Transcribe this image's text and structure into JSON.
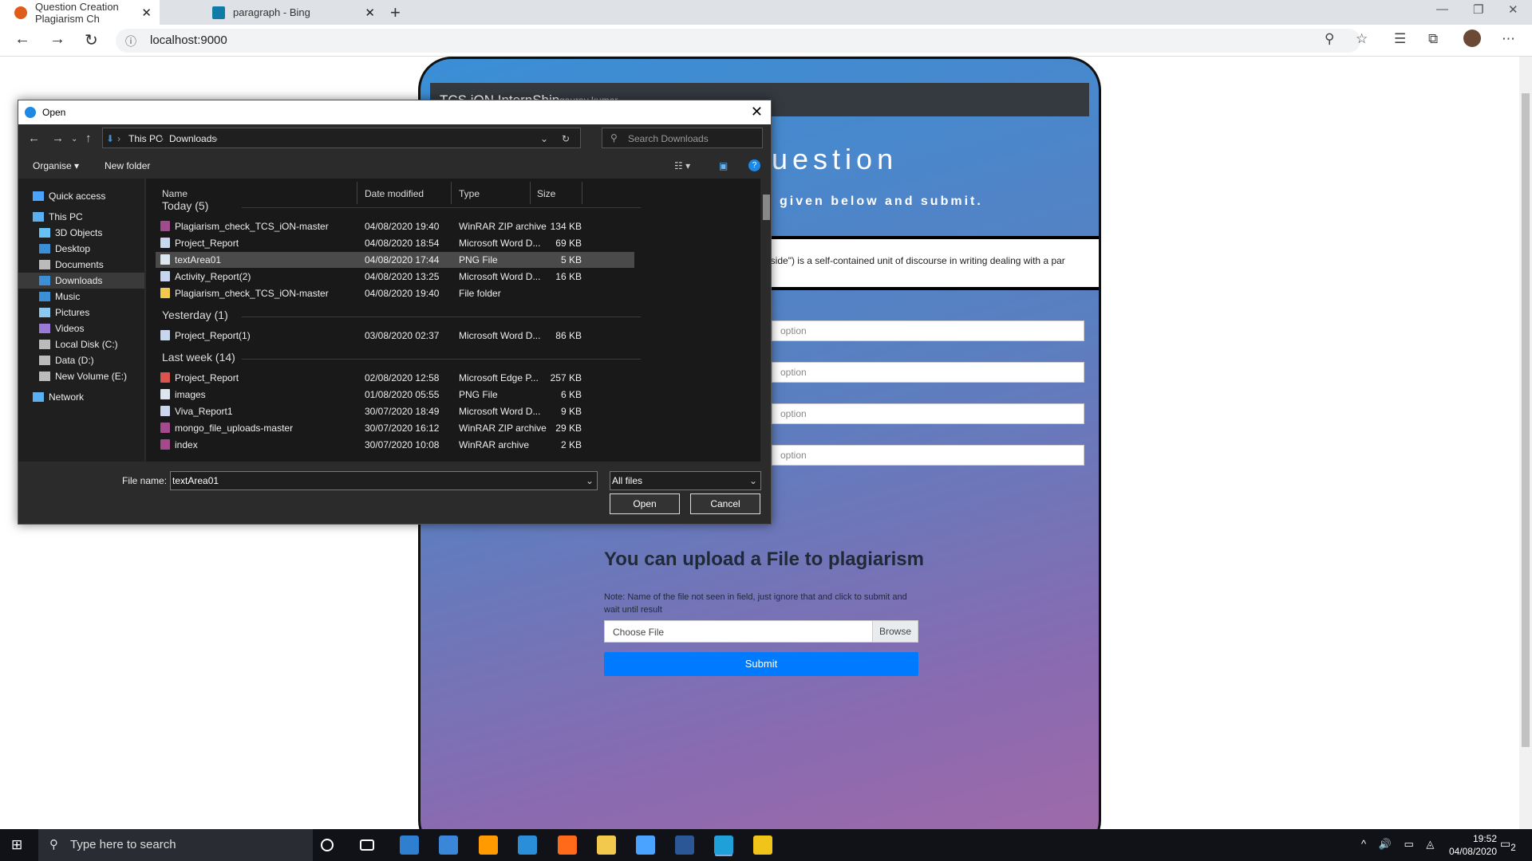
{
  "browser": {
    "tabs": [
      {
        "title": "Question Creation Plagiarism Ch",
        "icon": "page-favicon-icon",
        "color": "#e05c1a"
      },
      {
        "title": "paragraph - Bing",
        "icon": "bing-icon",
        "color": "#0f7ca8"
      }
    ],
    "url": "localhost:9000"
  },
  "page": {
    "brand": "TCS iON InternShip",
    "user": "gaurav kumar",
    "heading": "uestion",
    "subheading": "given below and submit.",
    "question_text": "eside\") is a self-contained unit of discourse in writing dealing with a par",
    "options": [
      "option",
      "option",
      "option",
      "option"
    ],
    "upload_title": "You can upload a File to plagiarism",
    "upload_note": "Note: Name of the file not seen in field, just ignore that and click to submit and wait until result",
    "file_placeholder": "Choose File",
    "browse_label": "Browse",
    "submit_label": "Submit"
  },
  "dialog": {
    "title": "Open",
    "breadcrumb": [
      "This PC",
      "Downloads"
    ],
    "search_placeholder": "Search Downloads",
    "organise": "Organise",
    "new_folder": "New folder",
    "sidebar": [
      {
        "label": "Quick access",
        "icon": "star-icon",
        "color": "#4aa3ff"
      },
      {
        "label": "This PC",
        "icon": "pc-icon",
        "color": "#5ab0f0"
      },
      {
        "label": "3D Objects",
        "icon": "3d-objects-icon",
        "color": "#66c1f5"
      },
      {
        "label": "Desktop",
        "icon": "desktop-icon",
        "color": "#3b8fd6"
      },
      {
        "label": "Documents",
        "icon": "documents-icon",
        "color": "#bbbbbb"
      },
      {
        "label": "Downloads",
        "icon": "downloads-icon",
        "color": "#3b8fd6"
      },
      {
        "label": "Music",
        "icon": "music-icon",
        "color": "#3b8fd6"
      },
      {
        "label": "Pictures",
        "icon": "pictures-icon",
        "color": "#8cc8f0"
      },
      {
        "label": "Videos",
        "icon": "videos-icon",
        "color": "#9b79d6"
      },
      {
        "label": "Local Disk (C:)",
        "icon": "drive-icon",
        "color": "#bbbbbb"
      },
      {
        "label": "Data (D:)",
        "icon": "drive-icon",
        "color": "#bbbbbb"
      },
      {
        "label": "New Volume (E:)",
        "icon": "drive-icon",
        "color": "#bbbbbb"
      },
      {
        "label": "Network",
        "icon": "network-icon",
        "color": "#5ab0f0"
      }
    ],
    "columns": [
      "Name",
      "Date modified",
      "Type",
      "Size"
    ],
    "groups": [
      {
        "label": "Today (5)",
        "rows": [
          {
            "name": "Plagiarism_check_TCS_iON-master",
            "date": "04/08/2020 19:40",
            "type": "WinRAR ZIP archive",
            "size": "134 KB",
            "icon": "winrar-icon",
            "color": "#a34a8c"
          },
          {
            "name": "Project_Report",
            "date": "04/08/2020 18:54",
            "type": "Microsoft Word D...",
            "size": "69 KB",
            "icon": "word-doc-icon",
            "color": "#c8d6ee"
          },
          {
            "name": "textArea01",
            "date": "04/08/2020 17:44",
            "type": "PNG File",
            "size": "5 KB",
            "icon": "png-file-icon",
            "color": "#dde6f0"
          },
          {
            "name": "Activity_Report(2)",
            "date": "04/08/2020 13:25",
            "type": "Microsoft Word D...",
            "size": "16 KB",
            "icon": "word-doc-icon",
            "color": "#c8d6ee"
          },
          {
            "name": "Plagiarism_check_TCS_iON-master",
            "date": "04/08/2020 19:40",
            "type": "File folder",
            "size": "",
            "icon": "folder-icon",
            "color": "#f2c94c"
          }
        ]
      },
      {
        "label": "Yesterday (1)",
        "rows": [
          {
            "name": "Project_Report(1)",
            "date": "03/08/2020 02:37",
            "type": "Microsoft Word D...",
            "size": "86 KB",
            "icon": "word-doc-icon",
            "color": "#c8d6ee"
          }
        ]
      },
      {
        "label": "Last week (14)",
        "rows": [
          {
            "name": "Project_Report",
            "date": "02/08/2020 12:58",
            "type": "Microsoft Edge P...",
            "size": "257 KB",
            "icon": "pdf-icon",
            "color": "#d9534f"
          },
          {
            "name": "images",
            "date": "01/08/2020 05:55",
            "type": "PNG File",
            "size": "6 KB",
            "icon": "png-file-icon",
            "color": "#dde6f0"
          },
          {
            "name": "Viva_Report1",
            "date": "30/07/2020 18:49",
            "type": "Microsoft Word D...",
            "size": "9 KB",
            "icon": "word-doc-icon",
            "color": "#c8d6ee"
          },
          {
            "name": "mongo_file_uploads-master",
            "date": "30/07/2020 16:12",
            "type": "WinRAR ZIP archive",
            "size": "29 KB",
            "icon": "winrar-icon",
            "color": "#a34a8c"
          },
          {
            "name": "index",
            "date": "30/07/2020 10:08",
            "type": "WinRAR archive",
            "size": "2 KB",
            "icon": "winrar-icon",
            "color": "#a34a8c"
          }
        ]
      }
    ],
    "file_name_label": "File name:",
    "file_name_value": "textArea01",
    "file_type": "All files",
    "open_label": "Open",
    "cancel_label": "Cancel"
  },
  "taskbar": {
    "search_placeholder": "Type here to search",
    "apps": [
      {
        "name": "cortana-icon",
        "color": "#ffffff"
      },
      {
        "name": "task-view-icon",
        "color": "#ffffff"
      },
      {
        "name": "mail-icon",
        "color": "#2f7fd1"
      },
      {
        "name": "store-icon",
        "color": "#3a86d8"
      },
      {
        "name": "illustrator-icon",
        "color": "#ff9a00"
      },
      {
        "name": "vscode-icon",
        "color": "#2a8fd8"
      },
      {
        "name": "firefox-icon",
        "color": "#ff6a1a"
      },
      {
        "name": "file-explorer-icon",
        "color": "#f2c94c"
      },
      {
        "name": "python-app-icon",
        "color": "#4aa3ff"
      },
      {
        "name": "word-icon",
        "color": "#2b5797"
      },
      {
        "name": "edge-icon",
        "color": "#1fa0d9"
      },
      {
        "name": "git-icon",
        "color": "#f0c419"
      }
    ],
    "time": "19:52",
    "date": "04/08/2020",
    "notifications": "2"
  }
}
